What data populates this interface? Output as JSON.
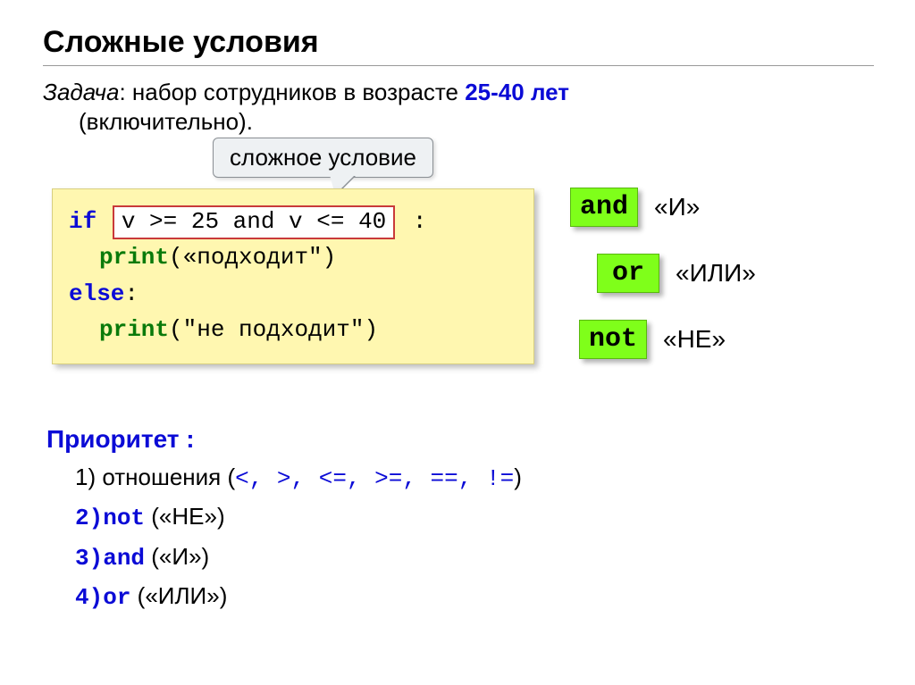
{
  "heading": "Сложные условия",
  "task": {
    "label": "Задача",
    "text": ": набор сотрудников в возрасте ",
    "age_range": "25-40 лет",
    "line2": "(включительно)."
  },
  "callout": "сложное условие",
  "code": {
    "if_kw": "if",
    "condition": "v >= 25 and v <= 40",
    "colon": " :",
    "print1_kw": "print",
    "print1_arg": "(«подходит\")",
    "else_kw": "else",
    "else_colon": ":",
    "print2_kw": "print",
    "print2_arg": "(\"не подходит\")"
  },
  "operators": [
    {
      "badge": "and",
      "label": "«И»"
    },
    {
      "badge": "or",
      "label": "«ИЛИ»"
    },
    {
      "badge": "not",
      "label": "«НЕ»"
    }
  ],
  "priority": {
    "title": "Приоритет :",
    "items": [
      {
        "prefix": "1) отношения (",
        "ops": "<, >, <=, >=, ==, !=",
        "suffix": ")"
      },
      {
        "num": "2)",
        "kw": "not",
        "label": "(«НЕ»)"
      },
      {
        "num": "3)",
        "kw": "and",
        "label": "(«И»)"
      },
      {
        "num": "4)",
        "kw": "or",
        "label": "(«ИЛИ»)"
      }
    ]
  }
}
